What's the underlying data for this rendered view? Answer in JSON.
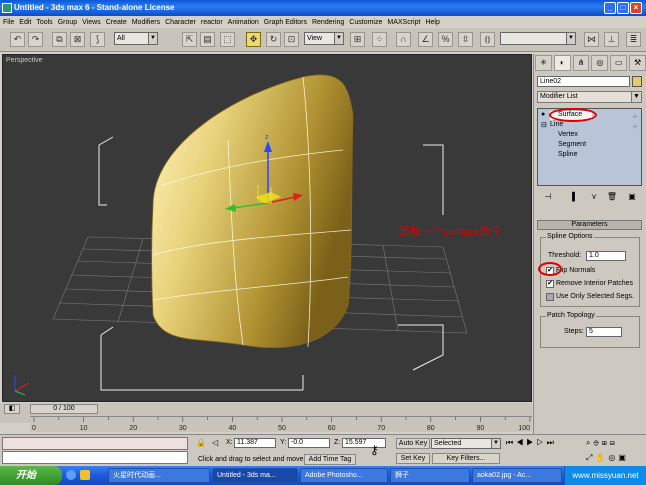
{
  "window": {
    "title": "Untitled - 3ds max 6 - Stand-alone License",
    "min": "_",
    "max": "□",
    "close": "×"
  },
  "menu": [
    "File",
    "Edit",
    "Tools",
    "Group",
    "Views",
    "Create",
    "Modifiers",
    "Character",
    "reactor",
    "Animation",
    "Graph Editors",
    "Rendering",
    "Customize",
    "MAXScript",
    "Help"
  ],
  "toolbar": {
    "selection_filter": "All",
    "ref_coord": "View",
    "named_sel": ""
  },
  "viewport": {
    "label": "Perspective",
    "annotation": "添加一个surface命令"
  },
  "panel": {
    "object_name": "Line02",
    "object_color": "#e8c868",
    "modifier_list": "Modifier List",
    "stack": [
      {
        "label": "Surface",
        "selected": true
      },
      {
        "label": "Line",
        "selected": false
      },
      {
        "label": "Vertex",
        "selected": false
      },
      {
        "label": "Segment",
        "selected": false
      },
      {
        "label": "Spline",
        "selected": false
      }
    ],
    "rollout_title": "Parameters",
    "spline_options": {
      "title": "Spline Options",
      "threshold_label": "Threshold:",
      "threshold_value": "1.0",
      "flip_normals": "Flip Normals",
      "remove_interior": "Remove Interior Patches",
      "use_only_selected": "Use Only Selected Segs."
    },
    "patch_topology": {
      "title": "Patch Topology",
      "steps_label": "Steps:",
      "steps_value": "5"
    }
  },
  "timeline": {
    "slider": "0 / 100",
    "ticks": [
      "0",
      "10",
      "20",
      "30",
      "40",
      "50",
      "60",
      "70",
      "80",
      "90",
      "100"
    ]
  },
  "status": {
    "x_label": "X:",
    "x_value": "11.387",
    "y_label": "Y:",
    "y_value": "-0.0",
    "z_label": "Z:",
    "z_value": "15.597",
    "prompt": "Click and drag to select and move",
    "add_time_tag": "Add Time Tag",
    "auto_key": "Auto Key",
    "selected": "Selected",
    "set_key": "Set Key",
    "key_filters": "Key Filters..."
  },
  "taskbar": {
    "start": "开始",
    "tasks": [
      "火星时代动画...",
      "Untitled - 3ds ma...",
      "Adobe Photosho...",
      "狮子",
      "aoka02.jpg - Ac..."
    ],
    "tray": "www.missyuan.net"
  }
}
